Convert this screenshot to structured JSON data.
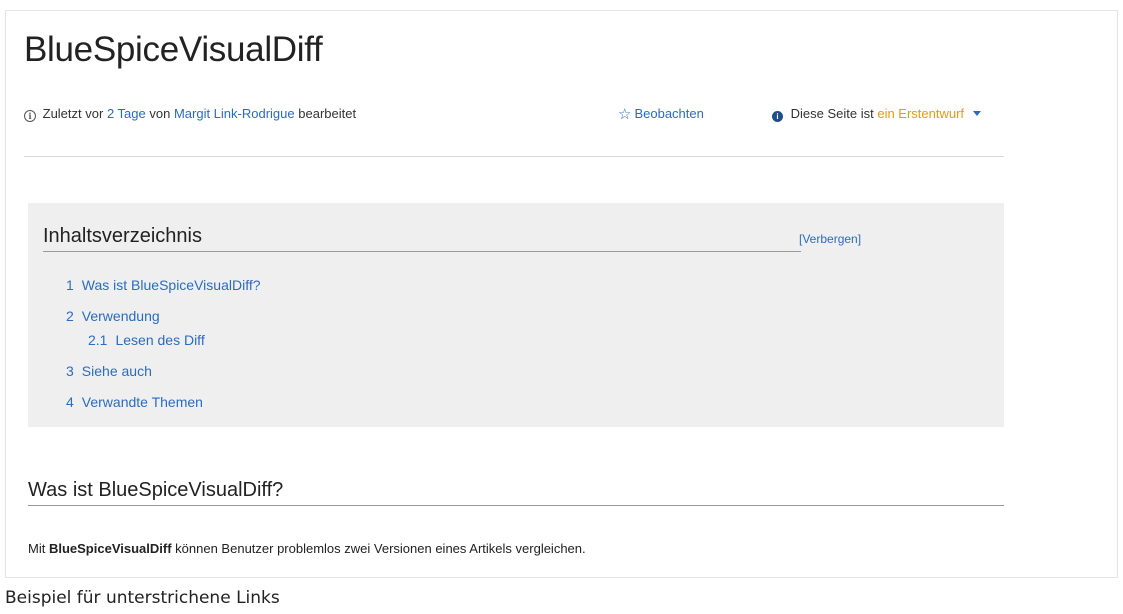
{
  "page": {
    "title": "BlueSpiceVisualDiff"
  },
  "meta": {
    "prefix": "Zuletzt vor",
    "time_link": "2 Tage",
    "by": "von",
    "author_link": "Margit Link-Rodrigue",
    "suffix": "bearbeitet",
    "watch_label": "Beobachten",
    "status_prefix": "Diese Seite ist",
    "status_value": "ein Erstentwurf",
    "icons": {
      "info": "info-icon",
      "watch": "star-icon",
      "status": "status-icon",
      "dropdown": "caret-down-icon"
    }
  },
  "toc": {
    "title": "Inhaltsverzeichnis",
    "toggle_label": "[Verbergen]",
    "items": [
      {
        "num": "1",
        "label": "Was ist BlueSpiceVisualDiff?"
      },
      {
        "num": "2",
        "label": "Verwendung"
      },
      {
        "num": "2.1",
        "label": "Lesen des Diff"
      },
      {
        "num": "3",
        "label": "Siehe auch"
      },
      {
        "num": "4",
        "label": "Verwandte Themen"
      }
    ]
  },
  "section": {
    "heading": "Was ist BlueSpiceVisualDiff?",
    "text_prefix": "Mit",
    "text_bold": "BlueSpiceVisualDiff",
    "text_suffix": "können Benutzer problemlos zwei Versionen eines Artikels vergleichen."
  },
  "caption": "Beispiel für unterstrichene Links",
  "colors": {
    "link": "#2a6bc4",
    "status": "#e89b0a",
    "toc_background": "#efefef"
  }
}
